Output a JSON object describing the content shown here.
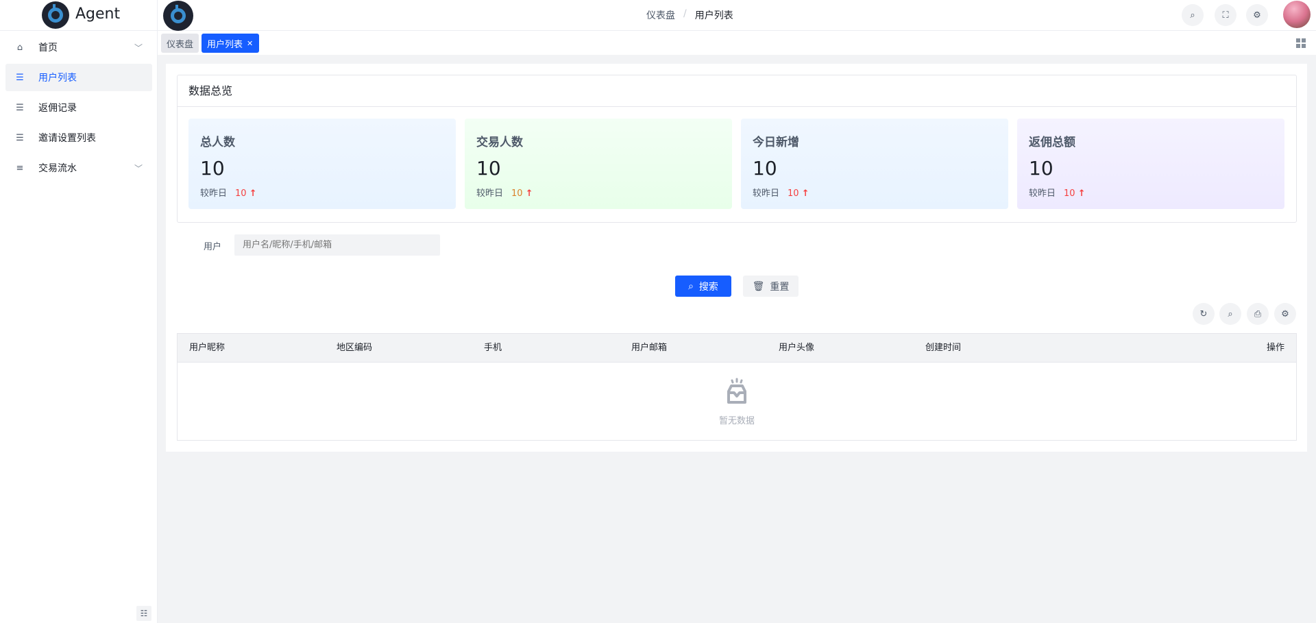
{
  "app": {
    "name": "Agent"
  },
  "sidebar": {
    "items": [
      {
        "label": "首页",
        "icon": "home-icon",
        "expandable": true
      },
      {
        "label": "用户列表",
        "icon": "list-icon",
        "active": true
      },
      {
        "label": "返佣记录",
        "icon": "list-icon"
      },
      {
        "label": "邀请设置列表",
        "icon": "list-icon"
      },
      {
        "label": "交易流水",
        "icon": "bullet-list-icon",
        "expandable": true
      }
    ]
  },
  "header": {
    "breadcrumb": [
      "仪表盘",
      "用户列表"
    ],
    "separator": "/"
  },
  "tabs": [
    {
      "label": "仪表盘"
    },
    {
      "label": "用户列表",
      "active": true,
      "close": "✕"
    }
  ],
  "overview": {
    "title": "数据总览",
    "compare_label": "较昨日",
    "cards": [
      {
        "title": "总人数",
        "value": "10",
        "delta": "10"
      },
      {
        "title": "交易人数",
        "value": "10",
        "delta": "10"
      },
      {
        "title": "今日新增",
        "value": "10",
        "delta": "10"
      },
      {
        "title": "返佣总额",
        "value": "10",
        "delta": "10"
      }
    ]
  },
  "search": {
    "label": "用户",
    "placeholder": "用户名/昵称/手机/邮箱",
    "search_btn": "搜索",
    "reset_btn": "重置"
  },
  "table": {
    "columns": [
      "用户昵称",
      "地区编码",
      "手机",
      "用户邮箱",
      "用户头像",
      "创建时间",
      "操作"
    ],
    "empty_text": "暂无数据"
  },
  "colors": {
    "primary": "#165dff",
    "up": "#f53f3f"
  }
}
